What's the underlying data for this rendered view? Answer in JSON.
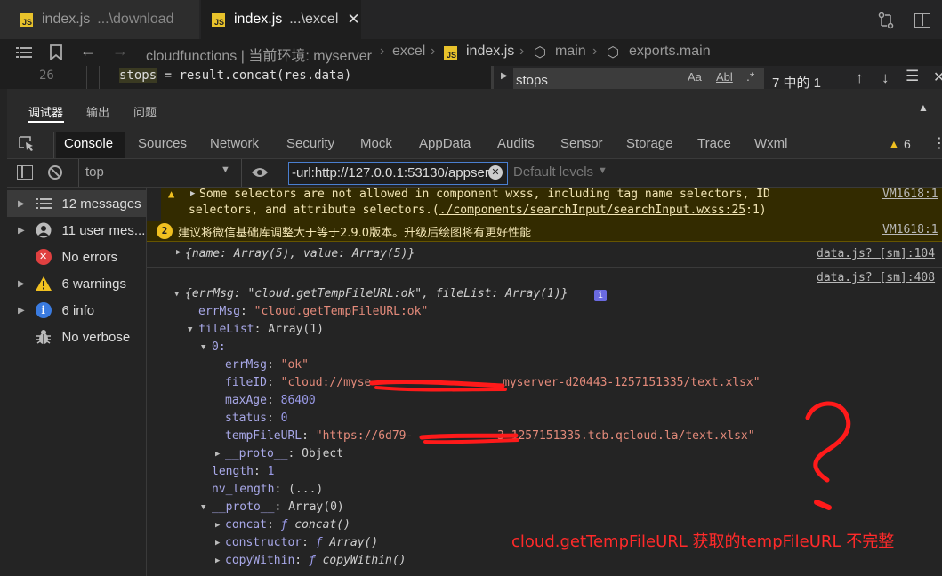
{
  "tabs": [
    {
      "file": "index.js",
      "path": "...\\download",
      "active": false
    },
    {
      "file": "index.js",
      "path": "...\\excel",
      "active": true
    }
  ],
  "breadcrumb": {
    "root": "cloudfunctions | 当前环境: myserver",
    "folder": "excel",
    "file": "index.js",
    "fn": "main",
    "member": "exports.main"
  },
  "editor": {
    "line_number": "26",
    "code_prefix": "stops",
    "code_rest": " = result.concat(res.data)"
  },
  "find": {
    "query": "stops",
    "match_info": "7 中的 1"
  },
  "debugger_tabs": [
    "调试器",
    "输出",
    "问题"
  ],
  "panel_tabs": [
    "Console",
    "Sources",
    "Network",
    "Security",
    "Mock",
    "AppData",
    "Audits",
    "Sensor",
    "Storage",
    "Trace",
    "Wxml"
  ],
  "warning_count": "6",
  "filter": {
    "context": "top",
    "input_value": "-url:http://127.0.0.1:53130/appservi",
    "levels": "Default levels"
  },
  "sidebar": [
    {
      "label": "12 messages",
      "icon": "list-icon"
    },
    {
      "label": "11 user mes...",
      "icon": "user-icon"
    },
    {
      "label": "No errors",
      "icon": "error-icon"
    },
    {
      "label": "6 warnings",
      "icon": "warning-icon"
    },
    {
      "label": "6 info",
      "icon": "info-icon"
    },
    {
      "label": "No verbose",
      "icon": "bug-icon"
    }
  ],
  "console": {
    "warn_line1": "Some selectors are not allowed in component wxss, including tag name selectors, ID",
    "warn_line2a": "selectors, and attribute selectors.(",
    "warn_link": "./components/searchInput/searchInput.wxss:25",
    "warn_line2b": ":1)",
    "warn_src": "VM1618:1",
    "info_count": "2",
    "info_text": "建议将微信基础库调整大于等于2.9.0版本。升级后绘图将有更好性能",
    "info_src": "VM1618:1",
    "obj1": "{name: Array(5), value: Array(5)}",
    "obj1_src": "data.js? [sm]:104",
    "obj2_src": "data.js? [sm]:408",
    "obj2_head": "{errMsg: \"cloud.getTempFileURL:ok\", fileList: Array(1)}",
    "errMsg_key": "errMsg",
    "errMsg_val": "\"cloud.getTempFileURL:ok\"",
    "fileList_key": "fileList",
    "fileList_val": "Array(1)",
    "item0": "0:",
    "item_errMsg_val": "\"ok\"",
    "fileID_val": "\"cloud://myse",
    "fileID_val_end": "myserver-d20443-1257151335/text.xlsx\"",
    "maxAge_val": "86400",
    "status_val": "0",
    "tempFileURL_val": "\"https://6d79-",
    "tempFileURL_val_end": "3-1257151335.tcb.qcloud.la/text.xlsx\"",
    "proto_obj": "Object",
    "length_val": "1",
    "nv_length_val": "(...)",
    "proto_arr": "Array(0)",
    "methods": [
      {
        "name": "concat",
        "fn": "concat()"
      },
      {
        "name": "constructor",
        "fn": "Array()"
      },
      {
        "name": "copyWithin",
        "fn": "copyWithin()"
      }
    ]
  },
  "annotation": {
    "text": "cloud.getTempFileURL 获取的tempFileURL  不完整",
    "color": "#ff2a2a"
  }
}
